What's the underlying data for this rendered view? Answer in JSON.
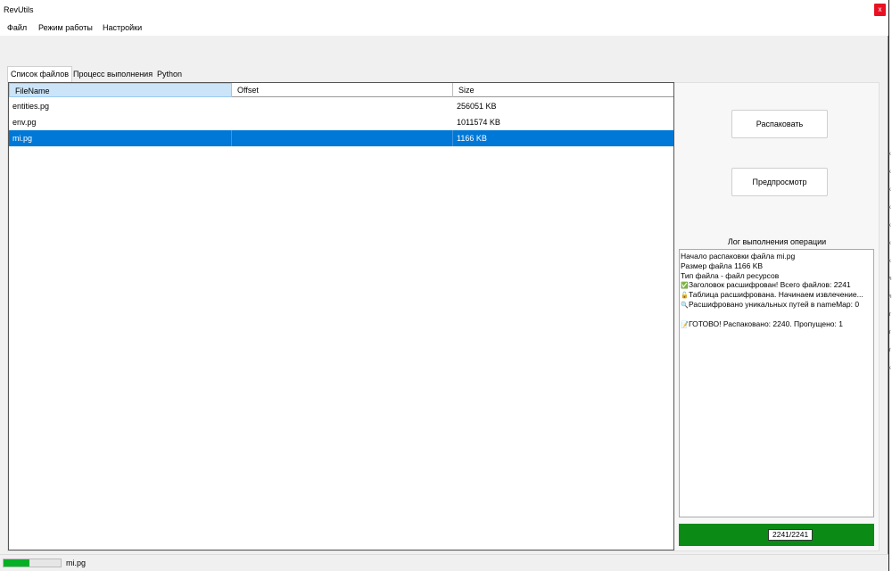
{
  "window": {
    "title": "RevUtils",
    "close_glyph": "x"
  },
  "menu": [
    "Файл",
    "Режим работы",
    "Настройки"
  ],
  "tabs": [
    "Список файлов",
    "Процесс выполнения",
    "Python"
  ],
  "active_tab": 0,
  "grid": {
    "columns": [
      "FileName",
      "Offset",
      "Size"
    ],
    "rows": [
      {
        "name": "entities.pg",
        "offset": "",
        "size": "256051 KB",
        "selected": false
      },
      {
        "name": "env.pg",
        "offset": "",
        "size": "1011574 KB",
        "selected": false
      },
      {
        "name": "mi.pg",
        "offset": "",
        "size": "1166 KB",
        "selected": true
      }
    ]
  },
  "buttons": {
    "unpack": "Распаковать",
    "preview": "Предпросмотр"
  },
  "log": {
    "title": "Лог выполнения операции",
    "lines": [
      {
        "icon": "",
        "text": "Начало распаковки файла mi.pg"
      },
      {
        "icon": "",
        "text": "Размер файла 1166 KB"
      },
      {
        "icon": "",
        "text": "Тип файла - файл ресурсов"
      },
      {
        "icon": "check-icon",
        "text": "Заголовок расшифрован! Всего файлов: 2241"
      },
      {
        "icon": "lock-icon",
        "text": "Таблица расшифрована. Начинаем извлечение..."
      },
      {
        "icon": "magnifier-icon",
        "text": "Расшифровано уникальных путей в nameMap: 0"
      },
      {
        "icon": "",
        "text": ""
      },
      {
        "icon": "document-icon",
        "text": "ГОТОВО! Распаковано: 2240. Пропущено: 1"
      }
    ]
  },
  "progress": {
    "label": "2241/2241",
    "value": 2241,
    "max": 2241,
    "color": "#0b8a16"
  },
  "status": {
    "file": "mi.pg",
    "progress_fraction": 0.45,
    "color": "#06b025"
  },
  "background_edge_letters": [
    "к",
    "к",
    "к",
    "к",
    "к",
    "к",
    "к",
    "л",
    "л",
    "т",
    "т",
    "т",
    "к"
  ]
}
